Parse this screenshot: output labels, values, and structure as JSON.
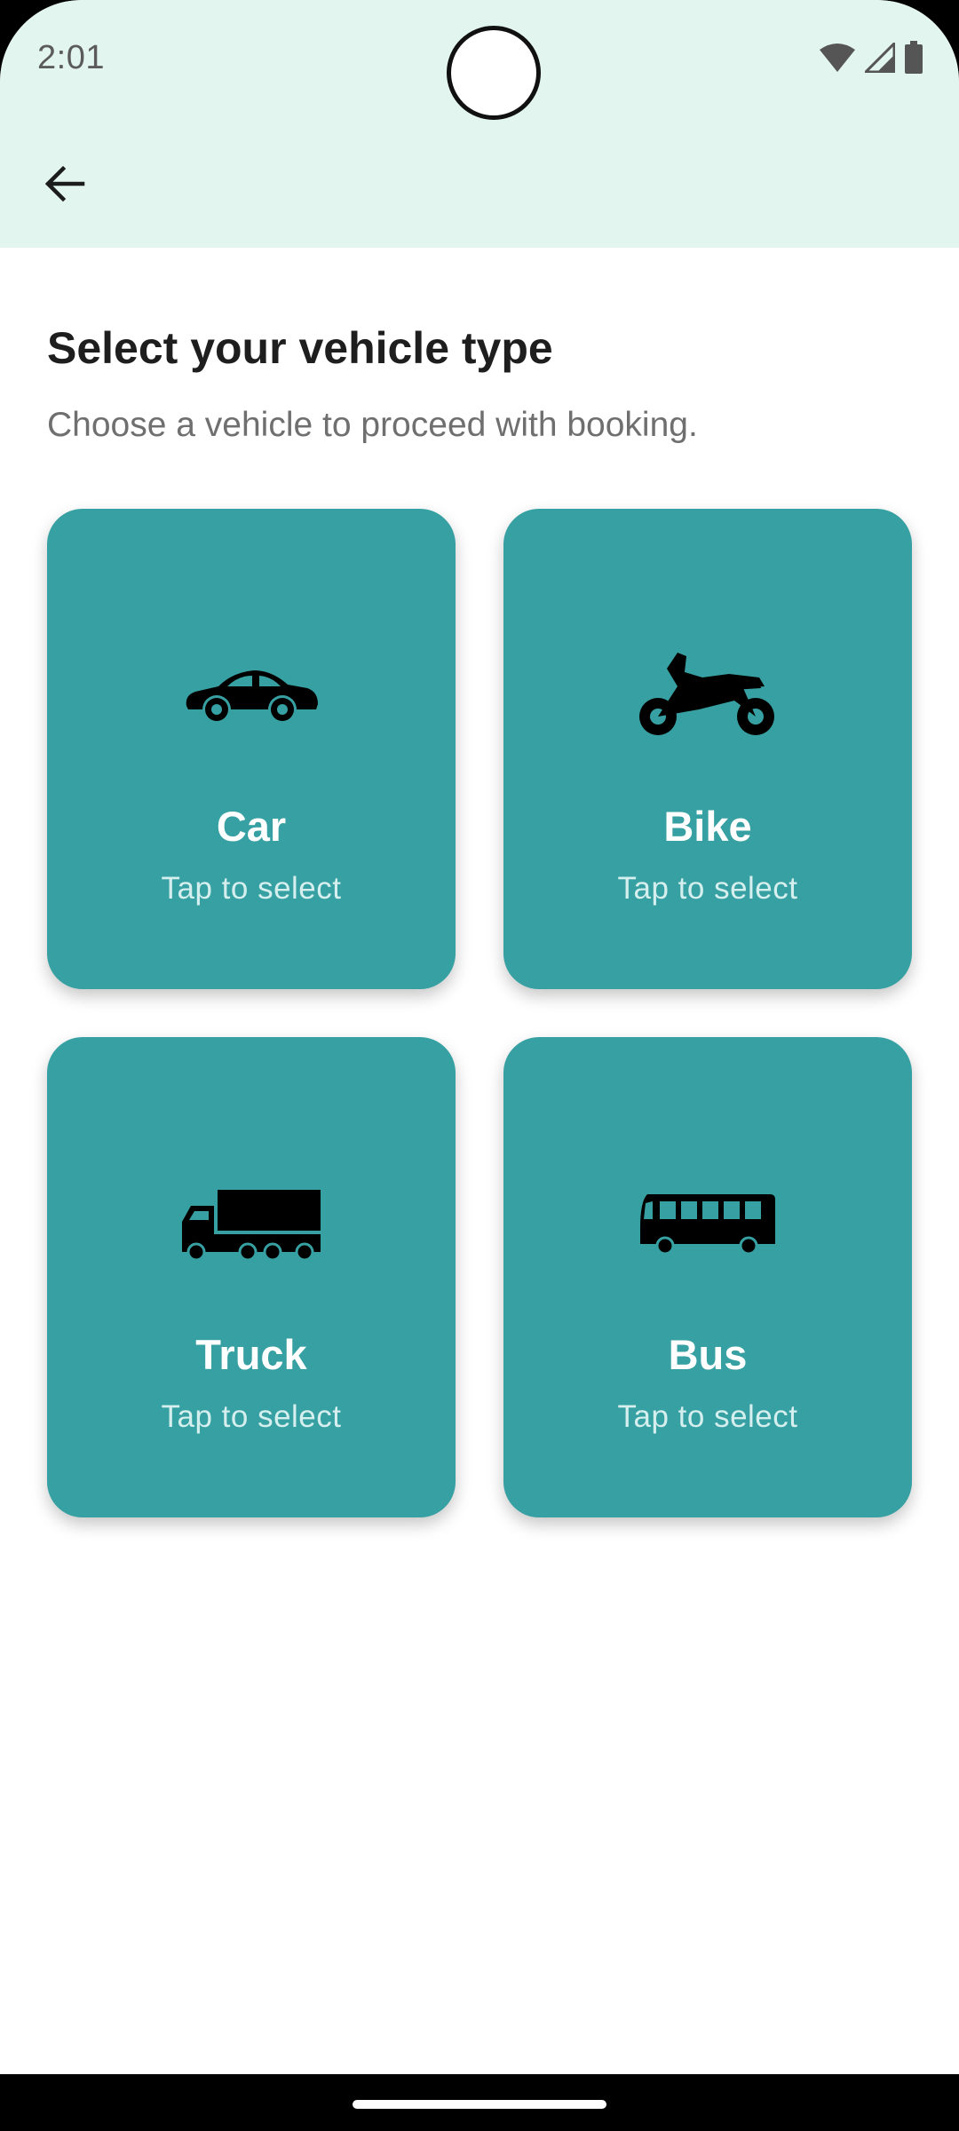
{
  "status_bar": {
    "time": "2:01",
    "icons": [
      "wifi-icon",
      "signal-icon",
      "battery-icon"
    ]
  },
  "app_bar": {
    "back_icon": "arrow-left-icon"
  },
  "page": {
    "title": "Select your vehicle type",
    "subtitle": "Choose a vehicle to proceed with booking."
  },
  "vehicles": [
    {
      "name": "Car",
      "hint": "Tap to select",
      "icon": "car-icon"
    },
    {
      "name": "Bike",
      "hint": "Tap to select",
      "icon": "motorcycle-icon"
    },
    {
      "name": "Truck",
      "hint": "Tap to select",
      "icon": "truck-icon"
    },
    {
      "name": "Bus",
      "hint": "Tap to select",
      "icon": "bus-icon"
    }
  ],
  "colors": {
    "app_bar_bg": "#e2f5ee",
    "card_bg": "#36a0a2",
    "card_text": "#ffffff"
  }
}
